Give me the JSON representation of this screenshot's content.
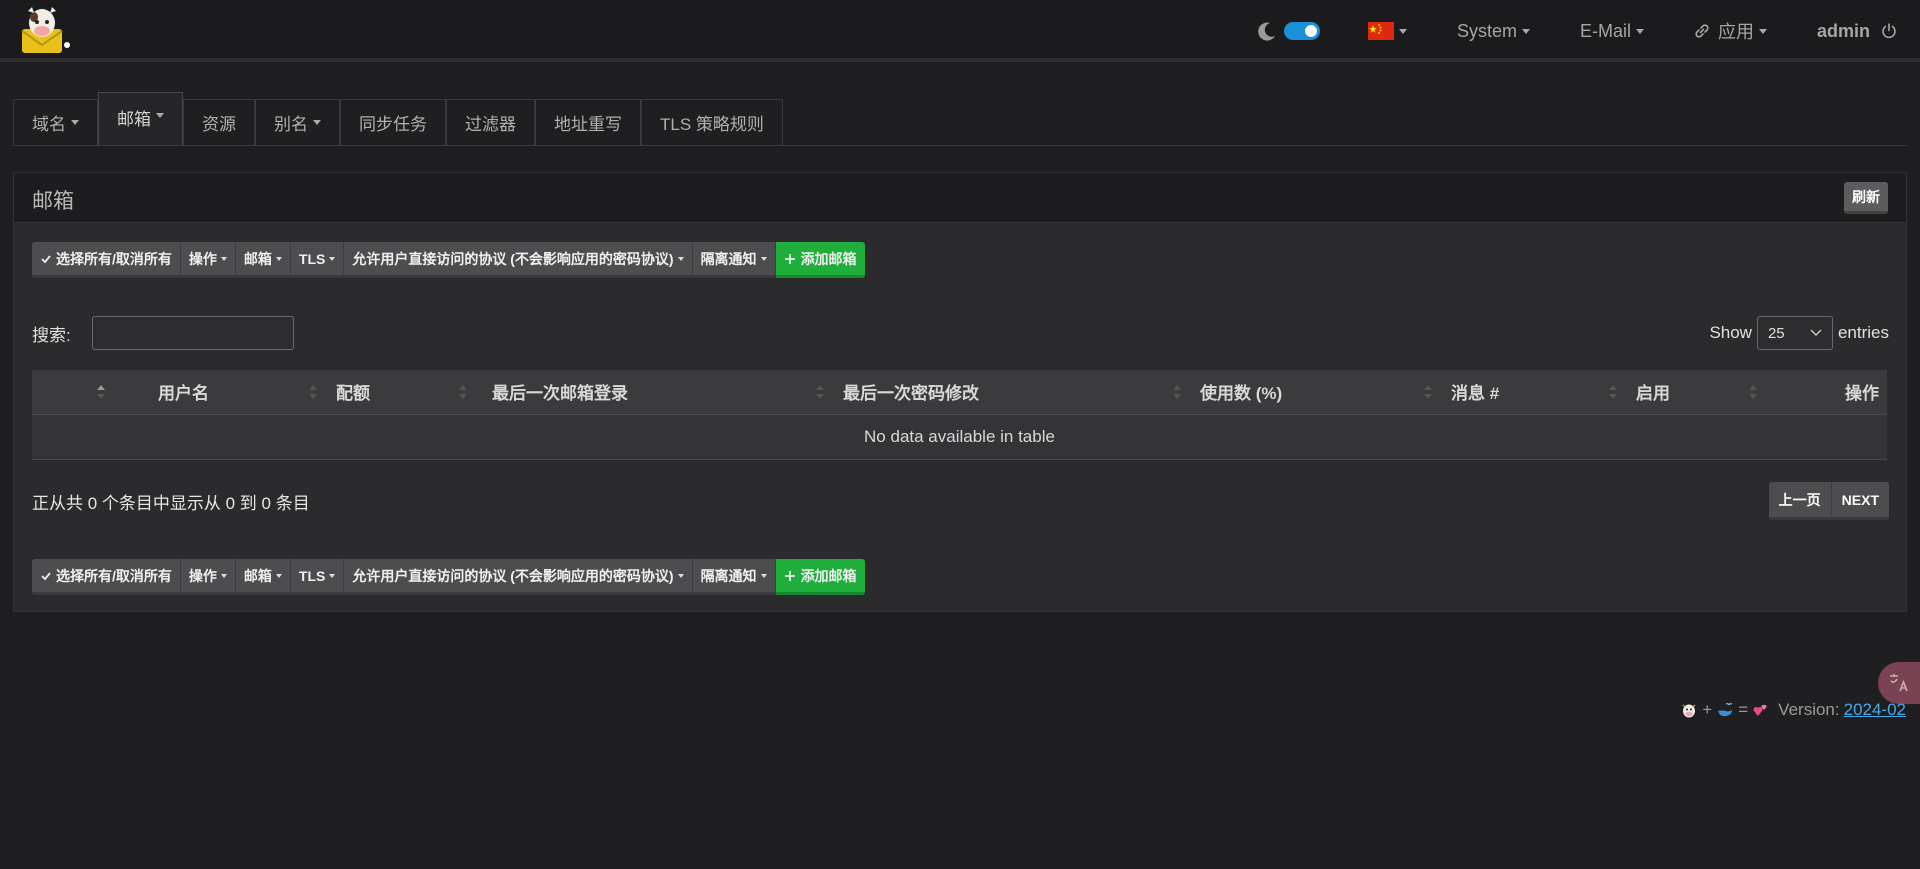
{
  "navbar": {
    "theme_toggle": "on",
    "flag": "china-flag",
    "system_label": "System",
    "email_label": "E-Mail",
    "apps_label": "应用",
    "user_label": "admin"
  },
  "tabs": [
    {
      "label": "域名",
      "dropdown": true
    },
    {
      "label": "邮箱",
      "dropdown": true,
      "active": true
    },
    {
      "label": "资源"
    },
    {
      "label": "别名",
      "dropdown": true
    },
    {
      "label": "同步任务"
    },
    {
      "label": "过滤器"
    },
    {
      "label": "地址重写"
    },
    {
      "label": "TLS 策略规则"
    }
  ],
  "panel": {
    "title": "邮箱",
    "refresh_label": "刷新"
  },
  "toolbar": {
    "select_all": "选择所有/取消所有",
    "actions": "操作",
    "mailbox": "邮箱",
    "tls": "TLS",
    "protocols": "允许用户直接访问的协议 (不会影响应用的密码协议)",
    "quarantine": "隔离通知",
    "add": "添加邮箱"
  },
  "search": {
    "label": "搜索:",
    "value": ""
  },
  "length": {
    "show": "Show",
    "value": "25",
    "entries": "entries"
  },
  "table": {
    "columns": [
      "",
      "用户名",
      "配额",
      "最后一次邮箱登录",
      "最后一次密码修改",
      "使用数 (%)",
      "消息 #",
      "启用",
      "操作"
    ],
    "empty": "No data available in table"
  },
  "info": "正从共 0 个条目中显示从 0 到 0 条目",
  "pager": {
    "prev": "上一页",
    "next": "NEXT"
  },
  "footer": {
    "plus": "+",
    "equals": "=",
    "version_label": "Version:",
    "version": "2024-02"
  },
  "colors": {
    "accent_green": "#1fae3c",
    "toggle_blue": "#1a90d8",
    "link_blue": "#4aa7e8"
  }
}
